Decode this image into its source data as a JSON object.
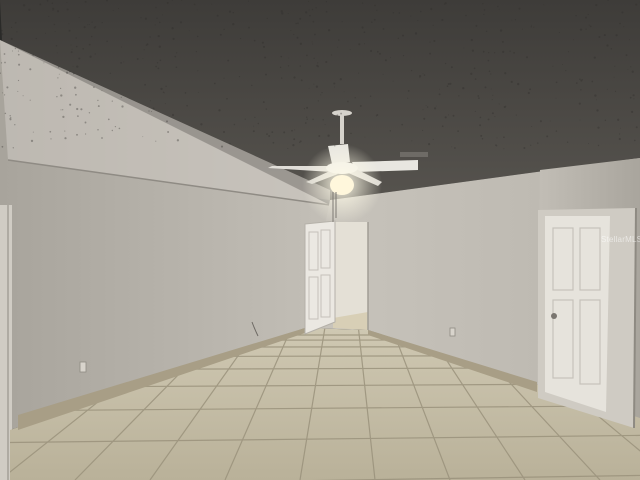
{
  "watermark": {
    "text": "StellarMLS"
  },
  "colors": {
    "ceiling": "#4c4a47",
    "left_wall": "#b7b3ab",
    "back_wall": "#c5c1b9",
    "right_wall": "#bcb8b0",
    "floor": "#c7bfa7",
    "grout": "#9a927c",
    "baseboard": "#a89e86",
    "door": "#e6e3dc",
    "fan": "#e8e6e0",
    "light": "#fff6d8"
  },
  "icons": [
    "ceiling-fan-icon",
    "door-icon",
    "outlet-icon"
  ]
}
